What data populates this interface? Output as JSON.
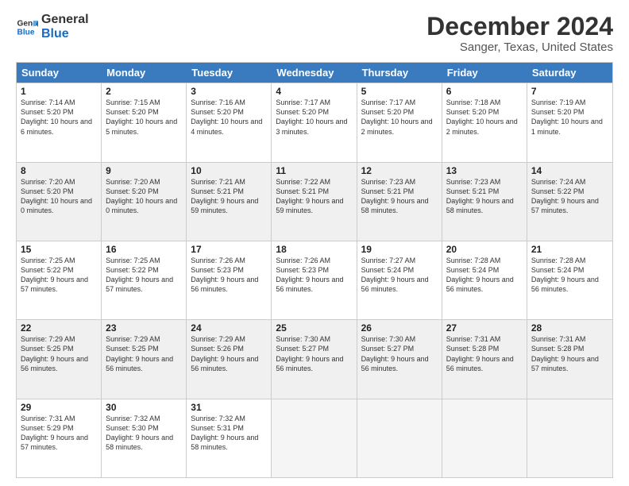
{
  "logo": {
    "line1": "General",
    "line2": "Blue"
  },
  "title": "December 2024",
  "subtitle": "Sanger, Texas, United States",
  "header_days": [
    "Sunday",
    "Monday",
    "Tuesday",
    "Wednesday",
    "Thursday",
    "Friday",
    "Saturday"
  ],
  "weeks": [
    [
      {
        "day": "1",
        "sunrise": "Sunrise: 7:14 AM",
        "sunset": "Sunset: 5:20 PM",
        "daylight": "Daylight: 10 hours and 6 minutes.",
        "shaded": false,
        "empty": false
      },
      {
        "day": "2",
        "sunrise": "Sunrise: 7:15 AM",
        "sunset": "Sunset: 5:20 PM",
        "daylight": "Daylight: 10 hours and 5 minutes.",
        "shaded": false,
        "empty": false
      },
      {
        "day": "3",
        "sunrise": "Sunrise: 7:16 AM",
        "sunset": "Sunset: 5:20 PM",
        "daylight": "Daylight: 10 hours and 4 minutes.",
        "shaded": false,
        "empty": false
      },
      {
        "day": "4",
        "sunrise": "Sunrise: 7:17 AM",
        "sunset": "Sunset: 5:20 PM",
        "daylight": "Daylight: 10 hours and 3 minutes.",
        "shaded": false,
        "empty": false
      },
      {
        "day": "5",
        "sunrise": "Sunrise: 7:17 AM",
        "sunset": "Sunset: 5:20 PM",
        "daylight": "Daylight: 10 hours and 2 minutes.",
        "shaded": false,
        "empty": false
      },
      {
        "day": "6",
        "sunrise": "Sunrise: 7:18 AM",
        "sunset": "Sunset: 5:20 PM",
        "daylight": "Daylight: 10 hours and 2 minutes.",
        "shaded": false,
        "empty": false
      },
      {
        "day": "7",
        "sunrise": "Sunrise: 7:19 AM",
        "sunset": "Sunset: 5:20 PM",
        "daylight": "Daylight: 10 hours and 1 minute.",
        "shaded": false,
        "empty": false
      }
    ],
    [
      {
        "day": "8",
        "sunrise": "Sunrise: 7:20 AM",
        "sunset": "Sunset: 5:20 PM",
        "daylight": "Daylight: 10 hours and 0 minutes.",
        "shaded": true,
        "empty": false
      },
      {
        "day": "9",
        "sunrise": "Sunrise: 7:20 AM",
        "sunset": "Sunset: 5:20 PM",
        "daylight": "Daylight: 10 hours and 0 minutes.",
        "shaded": true,
        "empty": false
      },
      {
        "day": "10",
        "sunrise": "Sunrise: 7:21 AM",
        "sunset": "Sunset: 5:21 PM",
        "daylight": "Daylight: 9 hours and 59 minutes.",
        "shaded": true,
        "empty": false
      },
      {
        "day": "11",
        "sunrise": "Sunrise: 7:22 AM",
        "sunset": "Sunset: 5:21 PM",
        "daylight": "Daylight: 9 hours and 59 minutes.",
        "shaded": true,
        "empty": false
      },
      {
        "day": "12",
        "sunrise": "Sunrise: 7:23 AM",
        "sunset": "Sunset: 5:21 PM",
        "daylight": "Daylight: 9 hours and 58 minutes.",
        "shaded": true,
        "empty": false
      },
      {
        "day": "13",
        "sunrise": "Sunrise: 7:23 AM",
        "sunset": "Sunset: 5:21 PM",
        "daylight": "Daylight: 9 hours and 58 minutes.",
        "shaded": true,
        "empty": false
      },
      {
        "day": "14",
        "sunrise": "Sunrise: 7:24 AM",
        "sunset": "Sunset: 5:22 PM",
        "daylight": "Daylight: 9 hours and 57 minutes.",
        "shaded": true,
        "empty": false
      }
    ],
    [
      {
        "day": "15",
        "sunrise": "Sunrise: 7:25 AM",
        "sunset": "Sunset: 5:22 PM",
        "daylight": "Daylight: 9 hours and 57 minutes.",
        "shaded": false,
        "empty": false
      },
      {
        "day": "16",
        "sunrise": "Sunrise: 7:25 AM",
        "sunset": "Sunset: 5:22 PM",
        "daylight": "Daylight: 9 hours and 57 minutes.",
        "shaded": false,
        "empty": false
      },
      {
        "day": "17",
        "sunrise": "Sunrise: 7:26 AM",
        "sunset": "Sunset: 5:23 PM",
        "daylight": "Daylight: 9 hours and 56 minutes.",
        "shaded": false,
        "empty": false
      },
      {
        "day": "18",
        "sunrise": "Sunrise: 7:26 AM",
        "sunset": "Sunset: 5:23 PM",
        "daylight": "Daylight: 9 hours and 56 minutes.",
        "shaded": false,
        "empty": false
      },
      {
        "day": "19",
        "sunrise": "Sunrise: 7:27 AM",
        "sunset": "Sunset: 5:24 PM",
        "daylight": "Daylight: 9 hours and 56 minutes.",
        "shaded": false,
        "empty": false
      },
      {
        "day": "20",
        "sunrise": "Sunrise: 7:28 AM",
        "sunset": "Sunset: 5:24 PM",
        "daylight": "Daylight: 9 hours and 56 minutes.",
        "shaded": false,
        "empty": false
      },
      {
        "day": "21",
        "sunrise": "Sunrise: 7:28 AM",
        "sunset": "Sunset: 5:24 PM",
        "daylight": "Daylight: 9 hours and 56 minutes.",
        "shaded": false,
        "empty": false
      }
    ],
    [
      {
        "day": "22",
        "sunrise": "Sunrise: 7:29 AM",
        "sunset": "Sunset: 5:25 PM",
        "daylight": "Daylight: 9 hours and 56 minutes.",
        "shaded": true,
        "empty": false
      },
      {
        "day": "23",
        "sunrise": "Sunrise: 7:29 AM",
        "sunset": "Sunset: 5:25 PM",
        "daylight": "Daylight: 9 hours and 56 minutes.",
        "shaded": true,
        "empty": false
      },
      {
        "day": "24",
        "sunrise": "Sunrise: 7:29 AM",
        "sunset": "Sunset: 5:26 PM",
        "daylight": "Daylight: 9 hours and 56 minutes.",
        "shaded": true,
        "empty": false
      },
      {
        "day": "25",
        "sunrise": "Sunrise: 7:30 AM",
        "sunset": "Sunset: 5:27 PM",
        "daylight": "Daylight: 9 hours and 56 minutes.",
        "shaded": true,
        "empty": false
      },
      {
        "day": "26",
        "sunrise": "Sunrise: 7:30 AM",
        "sunset": "Sunset: 5:27 PM",
        "daylight": "Daylight: 9 hours and 56 minutes.",
        "shaded": true,
        "empty": false
      },
      {
        "day": "27",
        "sunrise": "Sunrise: 7:31 AM",
        "sunset": "Sunset: 5:28 PM",
        "daylight": "Daylight: 9 hours and 56 minutes.",
        "shaded": true,
        "empty": false
      },
      {
        "day": "28",
        "sunrise": "Sunrise: 7:31 AM",
        "sunset": "Sunset: 5:28 PM",
        "daylight": "Daylight: 9 hours and 57 minutes.",
        "shaded": true,
        "empty": false
      }
    ],
    [
      {
        "day": "29",
        "sunrise": "Sunrise: 7:31 AM",
        "sunset": "Sunset: 5:29 PM",
        "daylight": "Daylight: 9 hours and 57 minutes.",
        "shaded": false,
        "empty": false
      },
      {
        "day": "30",
        "sunrise": "Sunrise: 7:32 AM",
        "sunset": "Sunset: 5:30 PM",
        "daylight": "Daylight: 9 hours and 58 minutes.",
        "shaded": false,
        "empty": false
      },
      {
        "day": "31",
        "sunrise": "Sunrise: 7:32 AM",
        "sunset": "Sunset: 5:31 PM",
        "daylight": "Daylight: 9 hours and 58 minutes.",
        "shaded": false,
        "empty": false
      },
      {
        "day": "",
        "sunrise": "",
        "sunset": "",
        "daylight": "",
        "shaded": false,
        "empty": true
      },
      {
        "day": "",
        "sunrise": "",
        "sunset": "",
        "daylight": "",
        "shaded": false,
        "empty": true
      },
      {
        "day": "",
        "sunrise": "",
        "sunset": "",
        "daylight": "",
        "shaded": false,
        "empty": true
      },
      {
        "day": "",
        "sunrise": "",
        "sunset": "",
        "daylight": "",
        "shaded": false,
        "empty": true
      }
    ]
  ]
}
